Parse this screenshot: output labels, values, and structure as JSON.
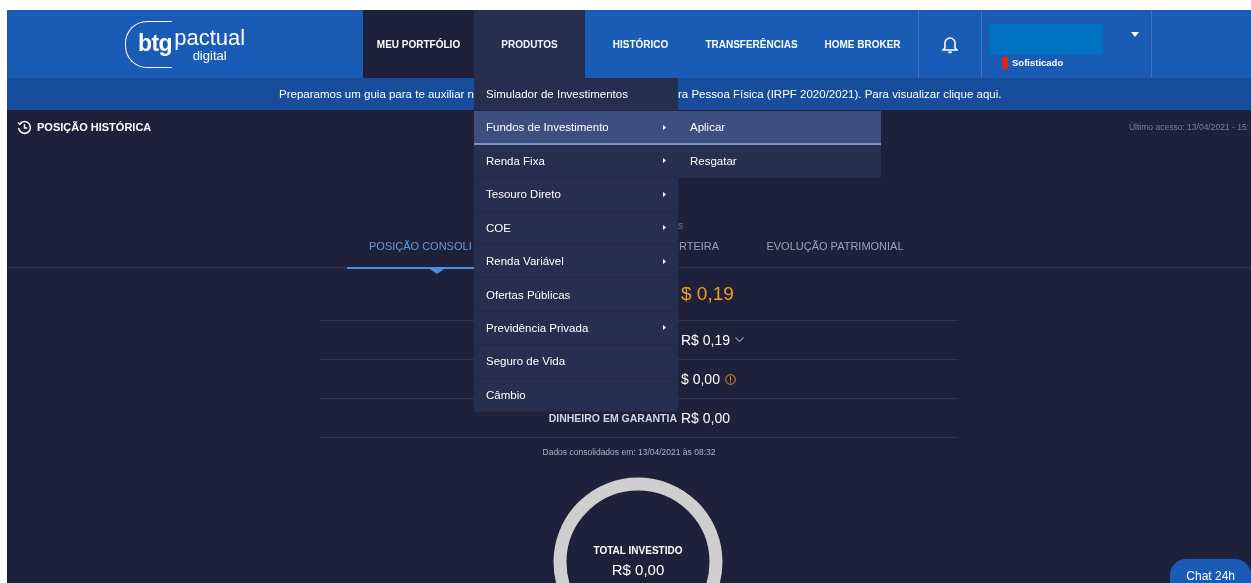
{
  "header": {
    "logo": {
      "brand": "btg",
      "name": "pactual",
      "sub": "digital"
    },
    "nav": [
      {
        "label": "MEU PORTFÓLIO",
        "selected": true,
        "open": false
      },
      {
        "label": "PRODUTOS",
        "selected": false,
        "open": true
      },
      {
        "label": "HISTÓRICO",
        "selected": false,
        "open": false
      },
      {
        "label": "TRANSFERÊNCIAS",
        "selected": false,
        "open": false
      },
      {
        "label": "HOME BROKER",
        "selected": false,
        "open": false
      }
    ],
    "user": {
      "profile": "Sofisticado"
    }
  },
  "banner": {
    "text_left": "Preparamos um guia para te auxiliar n",
    "text_right": "ra Pessoa Física (IRPF 2020/2021). Para visualizar clique aqui."
  },
  "products_menu": [
    {
      "label": "Simulador de Investimentos",
      "has_submenu": false,
      "highlighted": false
    },
    {
      "label": "Fundos de Investimento",
      "has_submenu": true,
      "highlighted": true
    },
    {
      "label": "Renda Fixa",
      "has_submenu": true,
      "highlighted": false
    },
    {
      "label": "Tesouro Direto",
      "has_submenu": true,
      "highlighted": false
    },
    {
      "label": "COE",
      "has_submenu": true,
      "highlighted": false
    },
    {
      "label": "Renda Variável",
      "has_submenu": true,
      "highlighted": false
    },
    {
      "label": "Ofertas Públicas",
      "has_submenu": false,
      "highlighted": false
    },
    {
      "label": "Previdência Privada",
      "has_submenu": true,
      "highlighted": false
    },
    {
      "label": "Seguro de Vida",
      "has_submenu": false,
      "highlighted": false
    },
    {
      "label": "Câmbio",
      "has_submenu": false,
      "highlighted": false
    }
  ],
  "submenu": [
    {
      "label": "Aplicar",
      "highlighted": true
    },
    {
      "label": "Resgatar",
      "highlighted": false
    }
  ],
  "history_link": "POSIÇÃO HISTÓRICA",
  "last_access": "Último acesso: 13/04/2021 - 15:",
  "subtitle": "s",
  "tabs": [
    {
      "label": "POSIÇÃO CONSOLI",
      "selected": true
    },
    {
      "label": "RTEIRA",
      "selected": false
    },
    {
      "label": "EVOLUÇÃO PATRIMONIAL",
      "selected": false
    }
  ],
  "summary": [
    {
      "kind": "total",
      "value": "$ 0,19"
    },
    {
      "kind": "expandable",
      "value": "R$ 0,19"
    },
    {
      "kind": "info",
      "value": "$ 0,00"
    },
    {
      "kind": "plain",
      "label": "DINHEIRO EM GARANTIA",
      "value": "R$ 0,00"
    }
  ],
  "consolidated_note": "Dados consolidados em: 13/04/2021 às 08:32",
  "donut": {
    "label": "TOTAL INVESTIDO",
    "value": "R$ 0,00"
  },
  "chat_button": "Chat 24h"
}
